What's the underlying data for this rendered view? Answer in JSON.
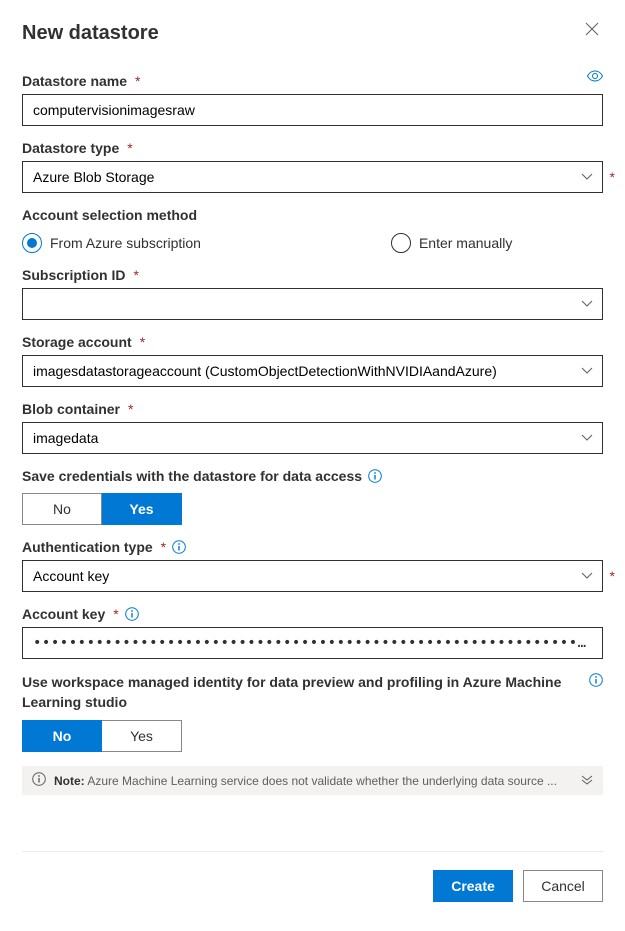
{
  "header": {
    "title": "New datastore"
  },
  "fields": {
    "datastore_name": {
      "label": "Datastore name",
      "value": "computervisionimagesraw"
    },
    "datastore_type": {
      "label": "Datastore type",
      "value": "Azure Blob Storage"
    },
    "account_selection": {
      "label": "Account selection method",
      "option_subscription": "From Azure subscription",
      "option_manual": "Enter manually"
    },
    "subscription_id": {
      "label": "Subscription ID",
      "value": ""
    },
    "storage_account": {
      "label": "Storage account",
      "value": "imagesdatastorageaccount (CustomObjectDetectionWithNVIDIAandAzure)"
    },
    "blob_container": {
      "label": "Blob container",
      "value": "imagedata"
    },
    "save_credentials": {
      "label": "Save credentials with the datastore for data access",
      "no": "No",
      "yes": "Yes"
    },
    "auth_type": {
      "label": "Authentication type",
      "value": "Account key"
    },
    "account_key": {
      "label": "Account key",
      "value": "••••••••••••••••••••••••••••••••••••••••••••••••••••••••••••••••••••••••••••••••••••••••••••••••••••••••••••••••••••••••••••••••••••••••••••••..."
    },
    "managed_identity": {
      "label": "Use workspace managed identity for data preview and profiling in Azure Machine Learning studio",
      "no": "No",
      "yes": "Yes"
    }
  },
  "note": {
    "prefix": "Note:",
    "text": "Azure Machine Learning service does not validate whether the underlying data source ..."
  },
  "footer": {
    "create": "Create",
    "cancel": "Cancel"
  }
}
